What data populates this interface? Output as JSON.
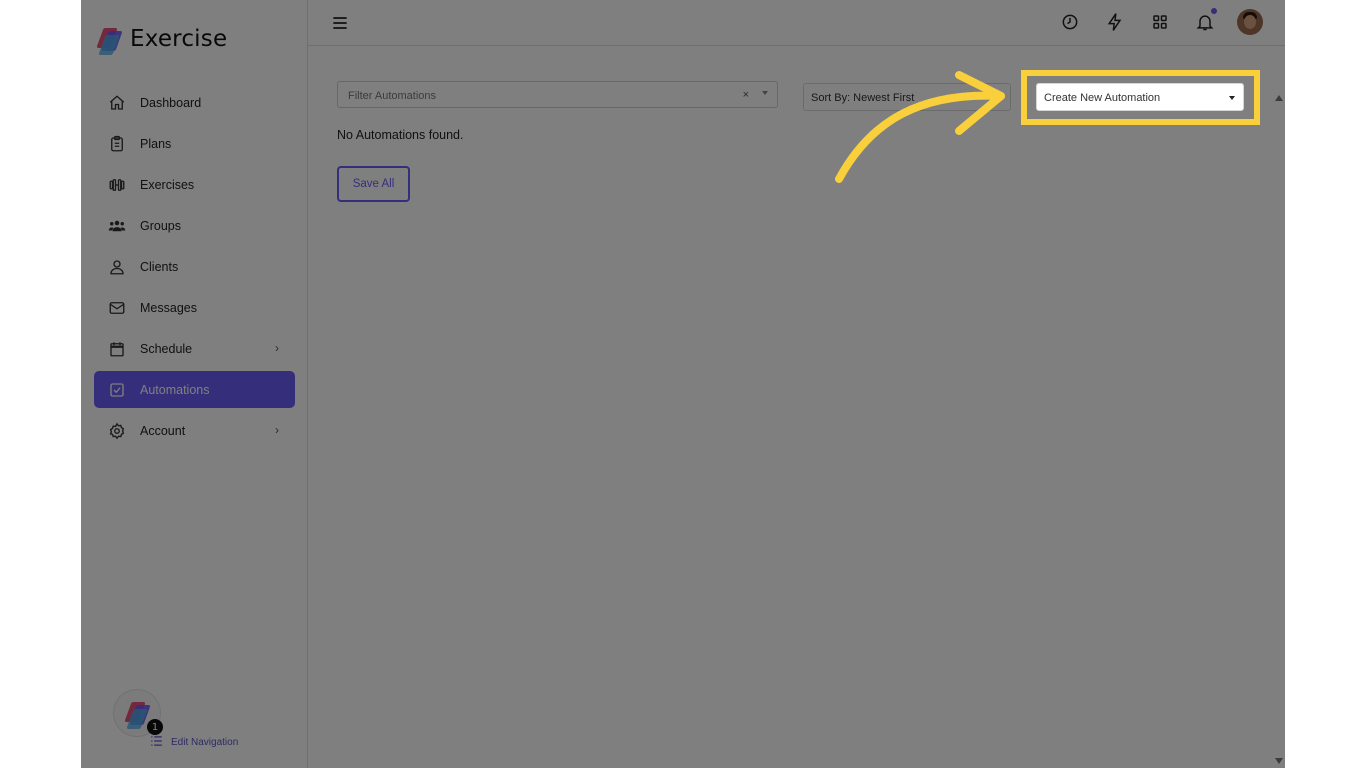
{
  "brand": {
    "name": "Exercise"
  },
  "sidebar": {
    "items": [
      {
        "label": "Dashboard",
        "icon": "home-icon"
      },
      {
        "label": "Plans",
        "icon": "clipboard-icon"
      },
      {
        "label": "Exercises",
        "icon": "dumbbell-icon"
      },
      {
        "label": "Groups",
        "icon": "group-icon"
      },
      {
        "label": "Clients",
        "icon": "user-icon"
      },
      {
        "label": "Messages",
        "icon": "mail-icon"
      },
      {
        "label": "Schedule",
        "icon": "calendar-icon",
        "has_submenu": true
      },
      {
        "label": "Automations",
        "icon": "checkbox-icon",
        "active": true
      },
      {
        "label": "Account",
        "icon": "gear-icon",
        "has_submenu": true
      }
    ],
    "helper_badge": "1",
    "edit_navigation": "Edit Navigation"
  },
  "topbar": {
    "icons": [
      "history-icon",
      "lightning-icon",
      "apps-grid-icon",
      "bell-icon",
      "avatar"
    ],
    "has_notification": true
  },
  "main": {
    "filter_placeholder": "Filter Automations",
    "filter_clear": "×",
    "sort_label": "Sort By: Newest First",
    "create_label": "Create New Automation",
    "empty_message": "No Automations found.",
    "save_all": "Save All"
  },
  "colors": {
    "accent": "#6a5cf6",
    "highlight": "#f9d03c",
    "overlay": "rgba(0,0,0,0.5)"
  }
}
